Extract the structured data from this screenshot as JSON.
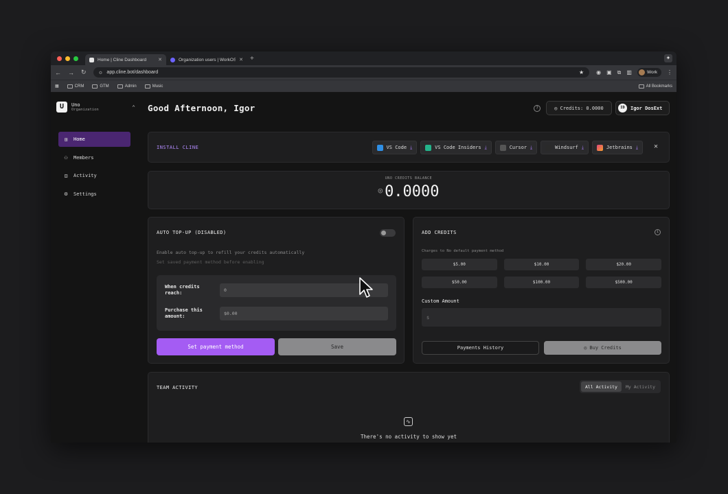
{
  "browser": {
    "tabs": [
      {
        "title": "Home | Cline Dashboard",
        "active": true
      },
      {
        "title": "Organization users | WorkOS",
        "active": false
      }
    ],
    "url": "app.cline.bot/dashboard",
    "profile": "Work",
    "bookmarks": [
      "CRM",
      "GTM",
      "Admin",
      "Music"
    ],
    "all_bookmarks": "All Bookmarks"
  },
  "org": {
    "name": "Uno",
    "type": "Organization",
    "logo_letter": "U"
  },
  "nav": [
    {
      "label": "Home",
      "icon": "grid-icon",
      "glyph": "⊞",
      "active": true
    },
    {
      "label": "Members",
      "icon": "users-icon",
      "glyph": "⚇",
      "active": false
    },
    {
      "label": "Activity",
      "icon": "activity-icon",
      "glyph": "⊡",
      "active": false
    },
    {
      "label": "Settings",
      "icon": "gear-icon",
      "glyph": "⚙",
      "active": false
    }
  ],
  "header": {
    "greeting": "Good Afternoon, Igor",
    "credits": "Credits: 0.0000",
    "user_initials": "ID",
    "user_name": "Igor DosExt"
  },
  "install": {
    "label": "INSTALL CLINE",
    "ides": [
      {
        "name": "VS Code",
        "color": "#2f8fe5"
      },
      {
        "name": "VS Code Insiders",
        "color": "#24b38a"
      },
      {
        "name": "Cursor",
        "color": "#555555"
      },
      {
        "name": "Windsurf",
        "color": "#2a2a2a"
      },
      {
        "name": "Jetbrains",
        "color": "#e0467c"
      }
    ]
  },
  "balance": {
    "label": "UNO CREDITS BALANCE",
    "value": "0.0000"
  },
  "auto_topup": {
    "title": "AUTO TOP-UP (DISABLED)",
    "description": "Enable auto top-up to refill your credits automatically",
    "hint": "Set saved payment method before enabling",
    "when_label_1": "When credits",
    "when_label_2": "reach:",
    "when_value": "0",
    "purchase_label_1": "Purchase this",
    "purchase_label_2": "amount:",
    "purchase_value": "$0.00",
    "set_payment": "Set payment method",
    "save": "Save",
    "enabled": false
  },
  "add_credits": {
    "title": "ADD CREDITS",
    "charges_note": "Charges to No default payment method",
    "amounts": [
      "$5.00",
      "$10.00",
      "$20.00",
      "$50.00",
      "$100.00",
      "$500.00"
    ],
    "custom_label": "Custom Amount",
    "custom_placeholder": "$",
    "history": "Payments History",
    "buy": "Buy Credits"
  },
  "team": {
    "title": "TEAM ACTIVITY",
    "filters": [
      "All Activity",
      "My Activity"
    ],
    "empty": "There's no activity to show yet"
  }
}
